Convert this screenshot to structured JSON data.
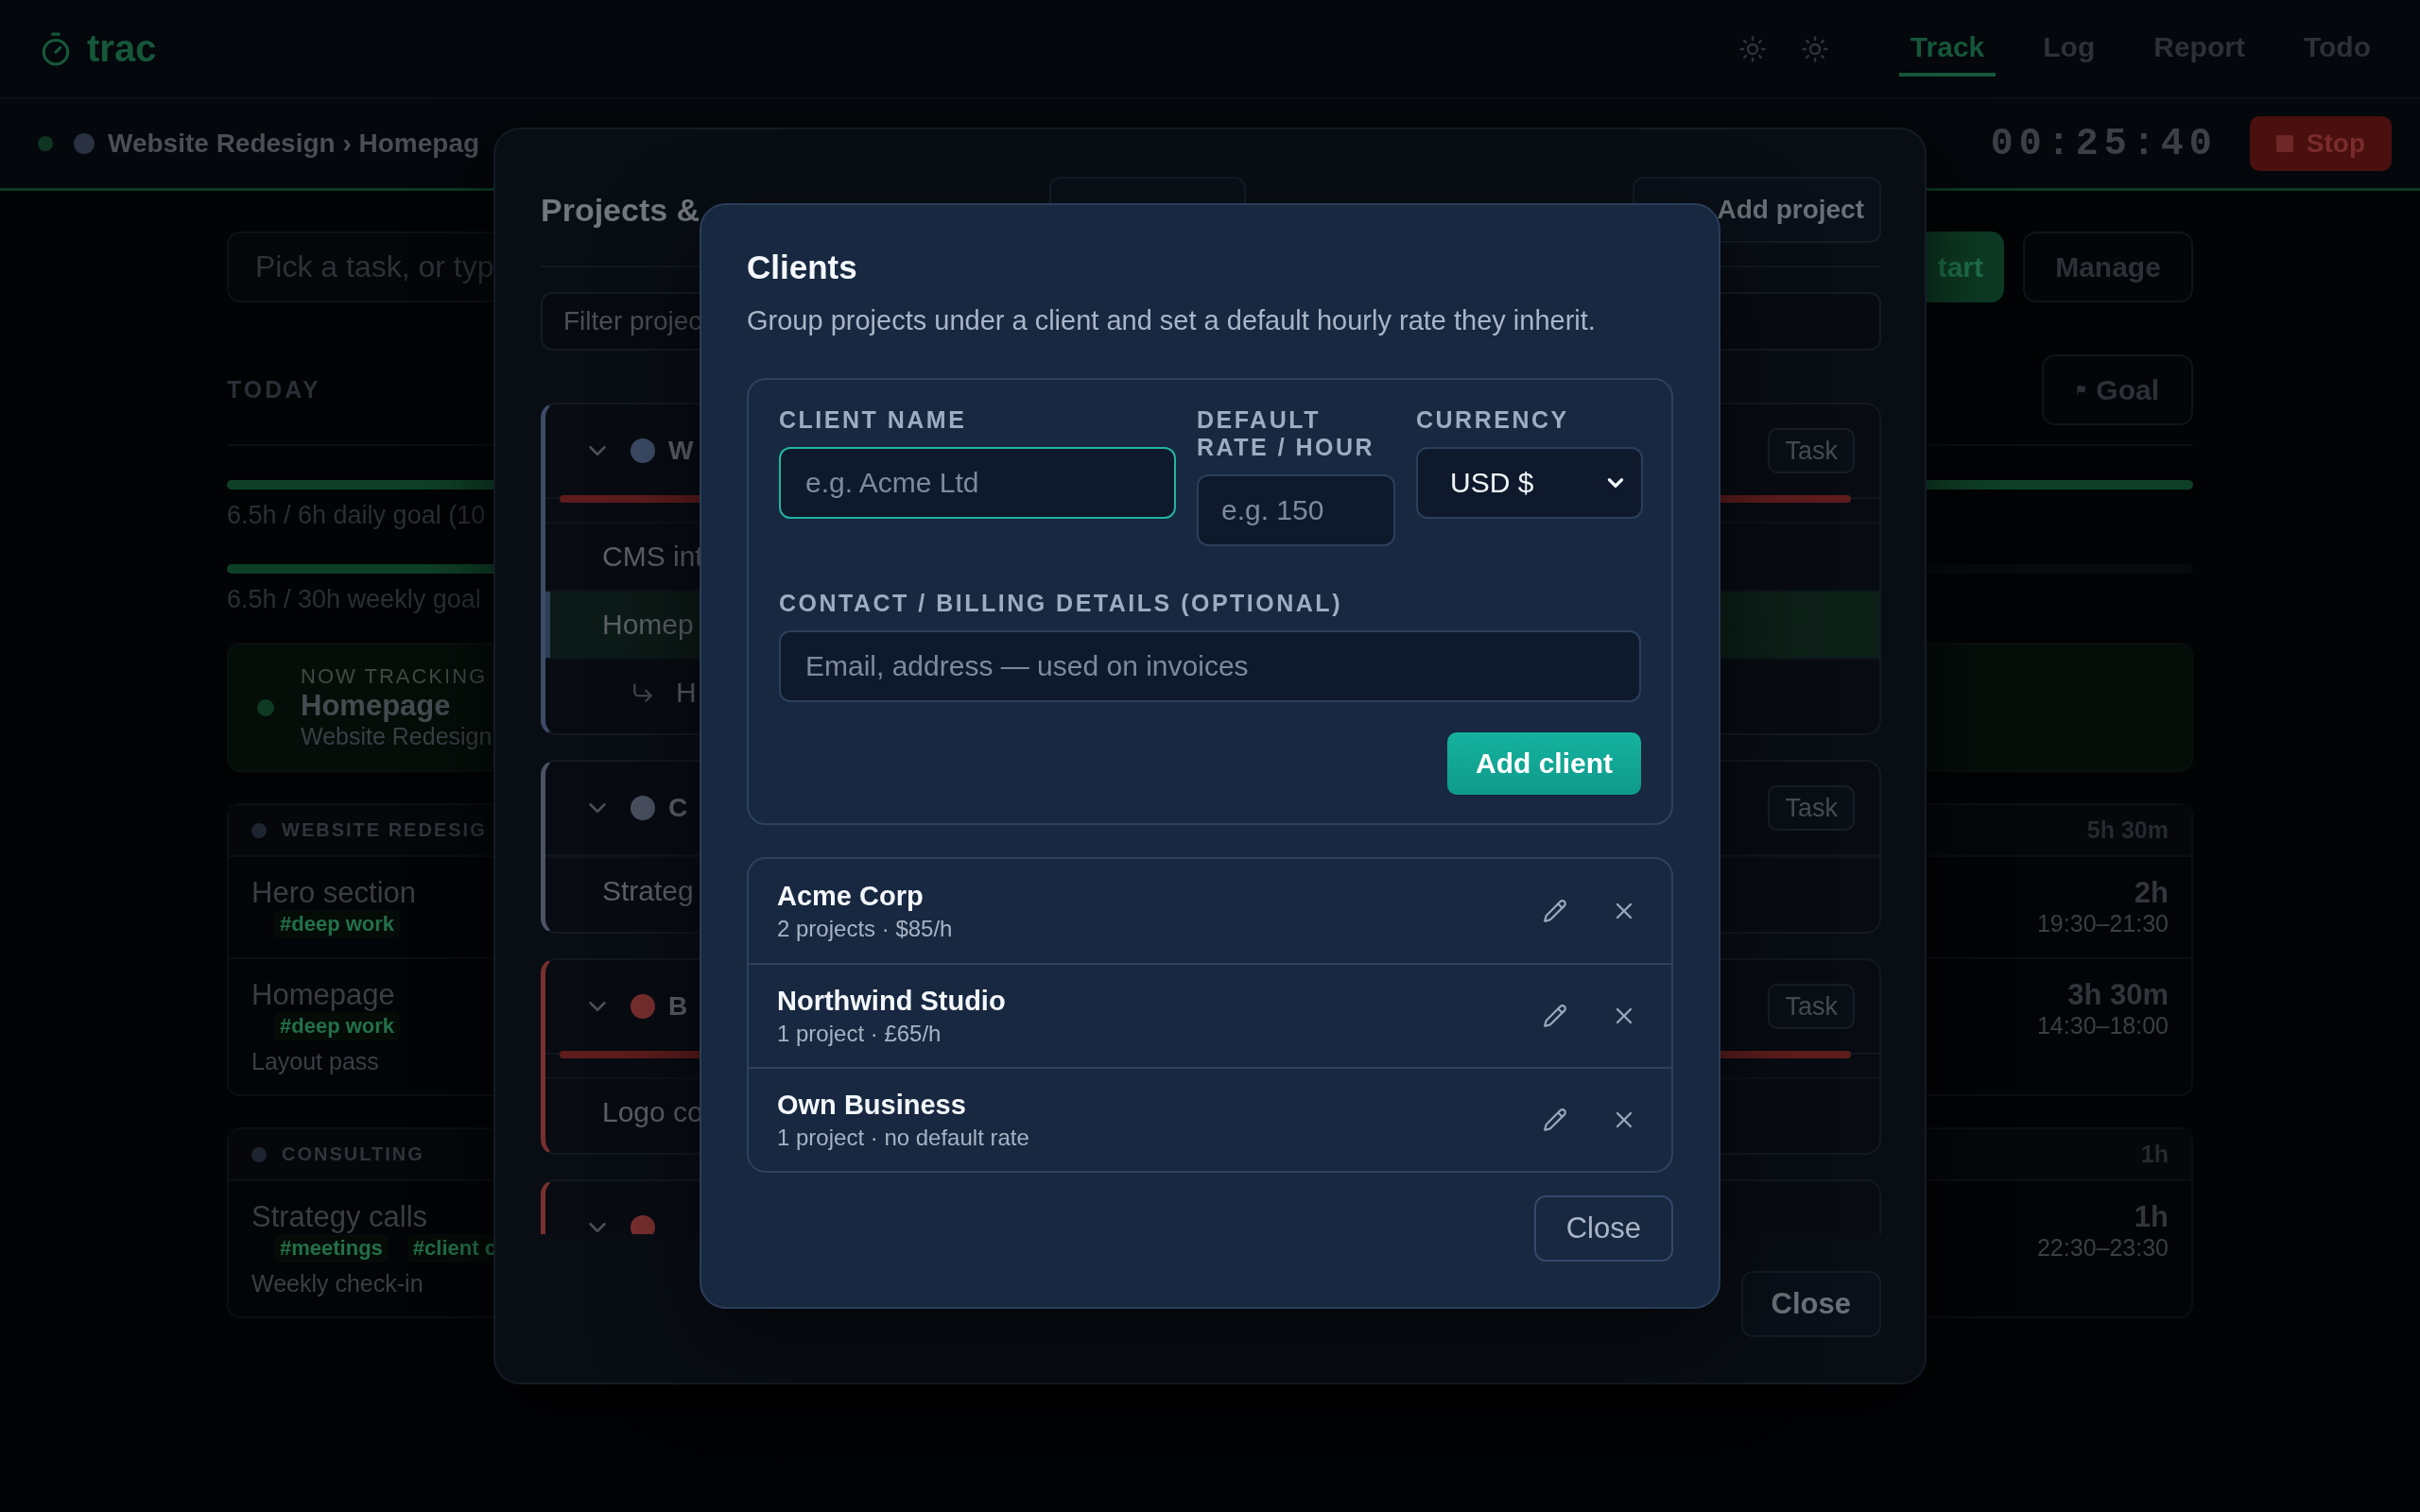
{
  "app": {
    "logo": "trac",
    "tabs": [
      {
        "label": "Track",
        "selected": true
      },
      {
        "label": "Log",
        "selected": false
      },
      {
        "label": "Report",
        "selected": false
      },
      {
        "label": "Todo",
        "selected": false
      }
    ]
  },
  "tracking_bar": {
    "breadcrumb": "Website Redesign › Homepag",
    "timer": "00:25:40",
    "stop_button": "Stop"
  },
  "tracker": {
    "placeholder": "Pick a task, or typ",
    "start_button": "tart",
    "manage_button": "Manage"
  },
  "today": {
    "heading": "TODAY",
    "goal_button": "Goal",
    "goals": [
      {
        "level": 1,
        "label": "6.5h / 6h daily goal (10"
      },
      {
        "level": 0.22,
        "label": "6.5h / 30h weekly goal"
      }
    ],
    "now_tracking": {
      "label": "NOW TRACKING",
      "task": "Homepage",
      "project": "Website Redesign"
    },
    "groups": [
      {
        "name": "WEBSITE REDESIG",
        "total": "5h 30m",
        "entries": [
          {
            "task": "Hero section",
            "tags": [
              "#deep work"
            ],
            "duration": "2h",
            "time": "19:30–21:30"
          },
          {
            "task": "Homepage",
            "tags": [
              "#deep work"
            ],
            "note": "Layout pass",
            "duration": "3h 30m",
            "time": "14:30–18:00"
          }
        ]
      },
      {
        "name": "CONSULTING",
        "total": "1h",
        "entries": [
          {
            "task": "Strategy calls",
            "tags": [
              "#meetings",
              "#client c"
            ],
            "note": "Weekly check-in",
            "duration": "1h",
            "time": "22:30–23:30"
          }
        ]
      }
    ]
  },
  "projects_dialog": {
    "title": "Projects &",
    "add_button": "Add project",
    "filter_placeholder": "Filter projec",
    "projects": [
      {
        "name": "W",
        "color": "#3d4b66",
        "task_button": "Task",
        "budget": {
          "level": 1
        },
        "tasks": [
          {
            "name": "CMS int",
            "selected": false
          },
          {
            "name": "Homep",
            "selected": true,
            "children": [
              {
                "name": "H"
              }
            ]
          }
        ]
      },
      {
        "name": "C",
        "color": "#4b5262",
        "task_button": "Task",
        "tasks": [
          {
            "name": "Strateg",
            "selected": false
          }
        ]
      },
      {
        "name": "B",
        "color": "#7a2f2f",
        "task_button": "Task",
        "budget": {
          "level": 1
        },
        "tasks": [
          {
            "name": "Logo co",
            "selected": false
          }
        ]
      },
      {
        "color": "#7a2f2f"
      }
    ],
    "close_button": "Close"
  },
  "clients_dialog": {
    "title": "Clients",
    "description": "Group projects under a client and set a default hourly rate they inherit.",
    "form": {
      "name_label": "CLIENT NAME",
      "name_placeholder": "e.g. Acme Ltd",
      "name_focused": true,
      "rate_label": "DEFAULT RATE / HOUR",
      "rate_placeholder": "e.g. 150",
      "currency_label": "CURRENCY",
      "currency": "USD $",
      "contact_label": "CONTACT / BILLING DETAILS (OPTIONAL)",
      "contact_placeholder": "Email, address — used on invoices",
      "add_button": "Add client"
    },
    "clients": [
      {
        "name": "Acme Corp",
        "details": "2 projects · $85/h"
      },
      {
        "name": "Northwind Studio",
        "details": "1 project · £65/h"
      },
      {
        "name": "Own Business",
        "details": "1 project · no default rate"
      }
    ],
    "close_button": "Close"
  }
}
